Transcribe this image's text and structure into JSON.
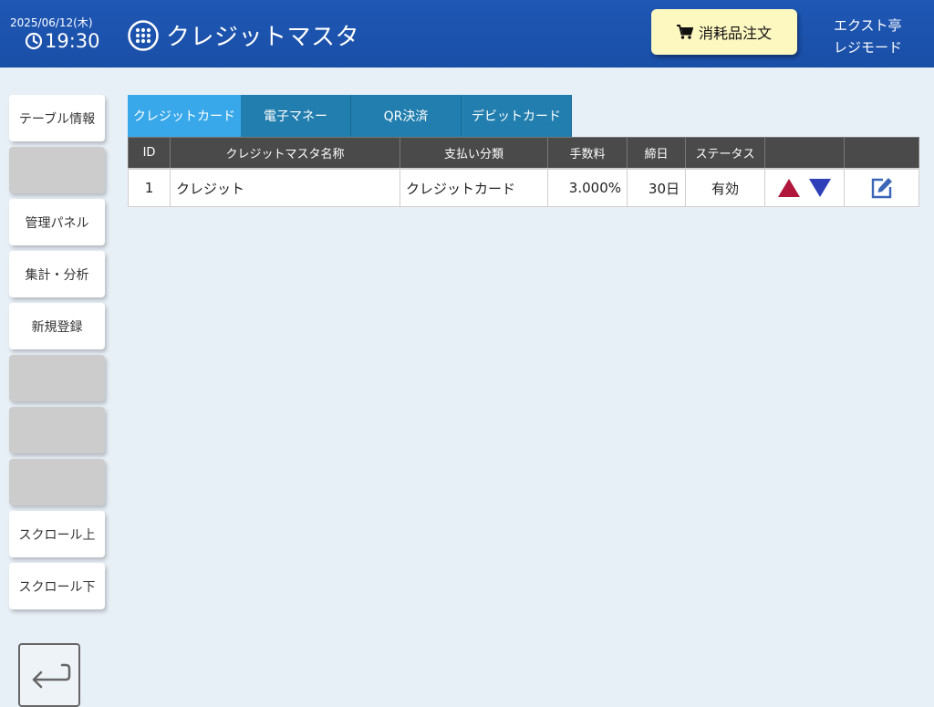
{
  "header": {
    "date": "2025/06/12(木)",
    "time": "19:30",
    "title": "クレジットマスタ",
    "supply_button": "消耗品注文",
    "shop_name": "エクスト亭",
    "mode": "レジモード"
  },
  "sidebar": {
    "items": [
      {
        "label": "テーブル情報"
      },
      {
        "label": ""
      },
      {
        "label": "管理パネル"
      },
      {
        "label": "集計・分析"
      },
      {
        "label": "新規登録"
      },
      {
        "label": ""
      },
      {
        "label": ""
      },
      {
        "label": ""
      },
      {
        "label": "スクロール上"
      },
      {
        "label": "スクロール下"
      }
    ]
  },
  "tabs": [
    {
      "label": "クレジットカード",
      "active": true
    },
    {
      "label": "電子マネー",
      "active": false
    },
    {
      "label": "QR決済",
      "active": false
    },
    {
      "label": "デビットカード",
      "active": false
    }
  ],
  "table": {
    "columns": [
      "ID",
      "クレジットマスタ名称",
      "支払い分類",
      "手数料",
      "締日",
      "ステータス",
      "",
      ""
    ],
    "rows": [
      {
        "id": "1",
        "name": "クレジット",
        "category": "クレジットカード",
        "fee": "3.000%",
        "closing_day": "30日",
        "status": "有効"
      }
    ]
  },
  "colors": {
    "header_bg": "#1e57b5",
    "supply_button_bg": "#fdf7c0",
    "tab_active": "#38a8ea",
    "tab_inactive": "#217eae",
    "arrow_up": "#b0173a",
    "arrow_down": "#2f3fb8"
  },
  "icons": [
    "clock-icon",
    "grid-menu-icon",
    "cart-icon",
    "move-up-icon",
    "move-down-icon",
    "edit-icon",
    "back-arrow-icon"
  ]
}
